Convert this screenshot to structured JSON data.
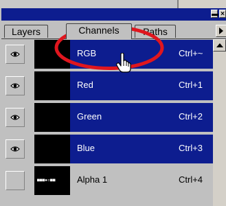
{
  "tabs": [
    {
      "label": "Layers",
      "active": false
    },
    {
      "label": "Channels",
      "active": true
    },
    {
      "label": "Paths",
      "active": false
    }
  ],
  "channels": [
    {
      "name": "RGB",
      "shortcut": "Ctrl+~",
      "visible": true,
      "selected": true
    },
    {
      "name": "Red",
      "shortcut": "Ctrl+1",
      "visible": true,
      "selected": true
    },
    {
      "name": "Green",
      "shortcut": "Ctrl+2",
      "visible": true,
      "selected": true
    },
    {
      "name": "Blue",
      "shortcut": "Ctrl+3",
      "visible": true,
      "selected": true
    },
    {
      "name": "Alpha 1",
      "shortcut": "Ctrl+4",
      "visible": false,
      "selected": false,
      "thumb_text": "■■■▪▫■■"
    }
  ],
  "colors": {
    "selection": "#0d1d8f",
    "annotation": "#e0161e",
    "panel": "#c0c0c0"
  },
  "icons": {
    "eye": "eye-icon",
    "cursor": "hand-pointer-icon",
    "menu": "panel-menu-icon",
    "close": "close-icon"
  }
}
